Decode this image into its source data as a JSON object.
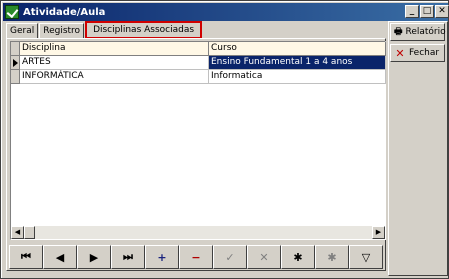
{
  "window": {
    "title": "Atividade/Aula"
  },
  "titlebar_buttons": [
    "_",
    "□",
    "✕"
  ],
  "tabs": [
    {
      "label": "Geral",
      "ul": "G"
    },
    {
      "label": "Registro",
      "ul": "R"
    },
    {
      "label": "Disciplinas Associadas",
      "ul": ""
    }
  ],
  "grid": {
    "columns": [
      "Disciplina",
      "Curso"
    ],
    "rows": [
      [
        "ARTES",
        "Ensino Fundamental 1 a 4 anos"
      ],
      [
        "INFORMÁTICA",
        "Informatica"
      ]
    ]
  },
  "navigator": {
    "first": "⏮",
    "prior": "◀",
    "next": "▶",
    "last": "⏭",
    "insert": "+",
    "delete": "−",
    "post": "✓",
    "cancel": "✕",
    "refresh": "✱",
    "filter_dim": "✱",
    "filter": "▽"
  },
  "side": {
    "report_label": "Relatório",
    "close_label": "Fechar"
  },
  "colors": {
    "accent": "#0a246a",
    "highlight": "#d00000"
  }
}
